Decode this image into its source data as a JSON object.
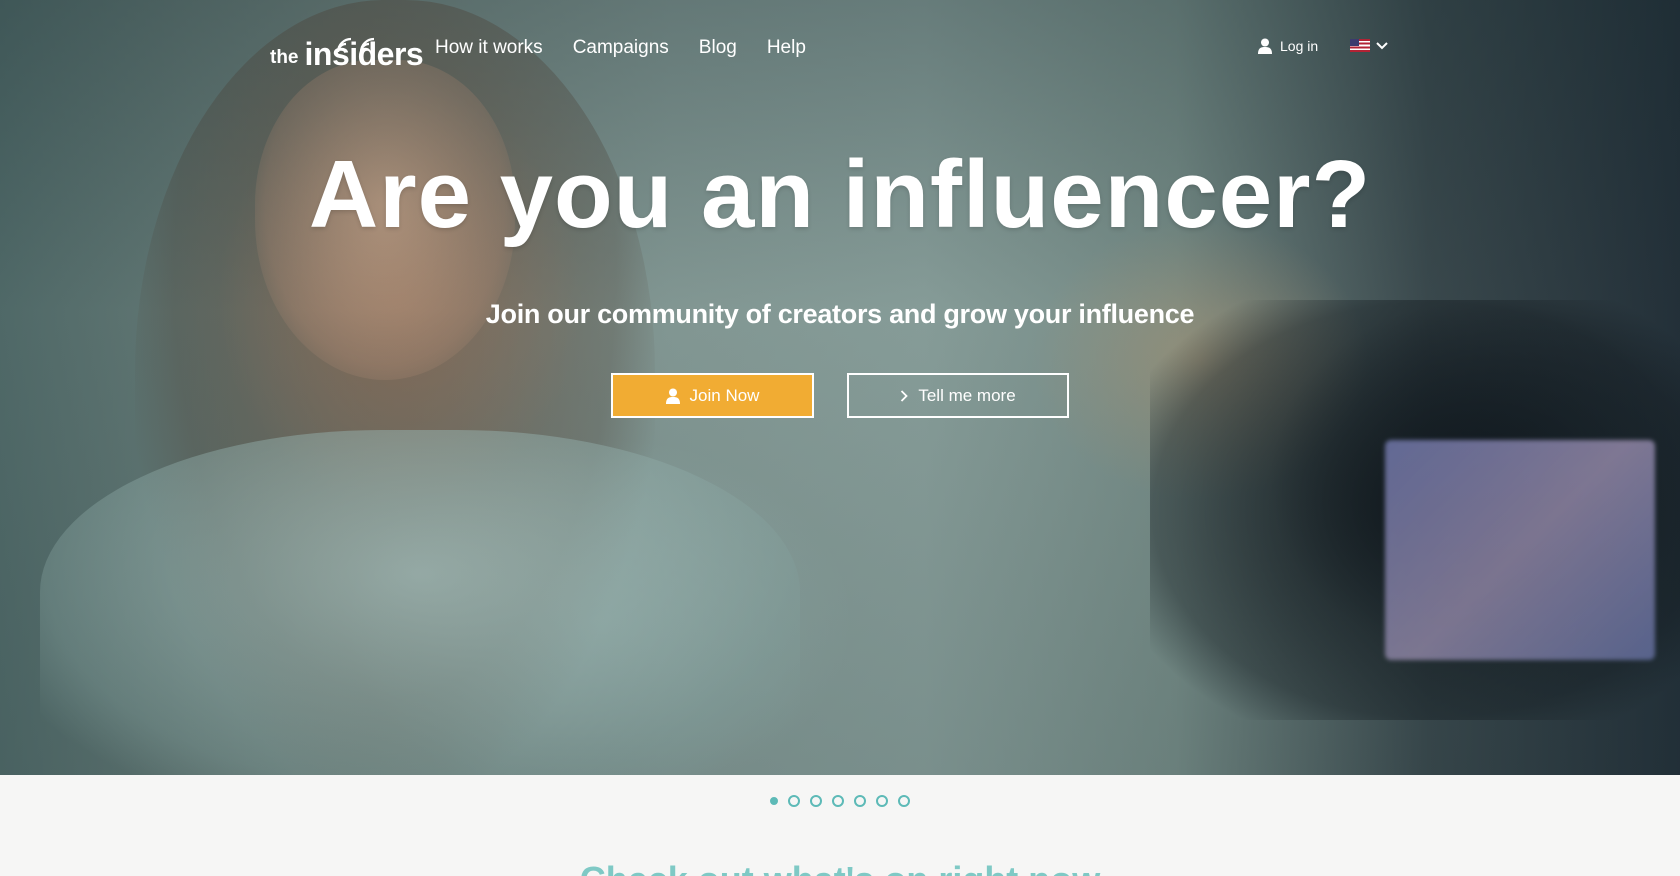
{
  "nav": {
    "logo": {
      "the": "the",
      "word": "insiders"
    },
    "links": [
      {
        "label": "How it works"
      },
      {
        "label": "Campaigns"
      },
      {
        "label": "Blog"
      },
      {
        "label": "Help"
      }
    ],
    "login_label": "Log in",
    "language": {
      "flag": "us-flag-icon"
    }
  },
  "hero": {
    "headline": "Are you an influencer?",
    "subline": "Join our community of creators and grow your influence",
    "join_button": "Join Now",
    "more_button": "Tell me more"
  },
  "carousel": {
    "total": 7,
    "active_index": 0
  },
  "section": {
    "title": "Check out what's on right now"
  },
  "colors": {
    "accent_orange": "#f1ac33",
    "accent_teal": "#5dbab7",
    "section_bg": "#f6f6f5"
  }
}
